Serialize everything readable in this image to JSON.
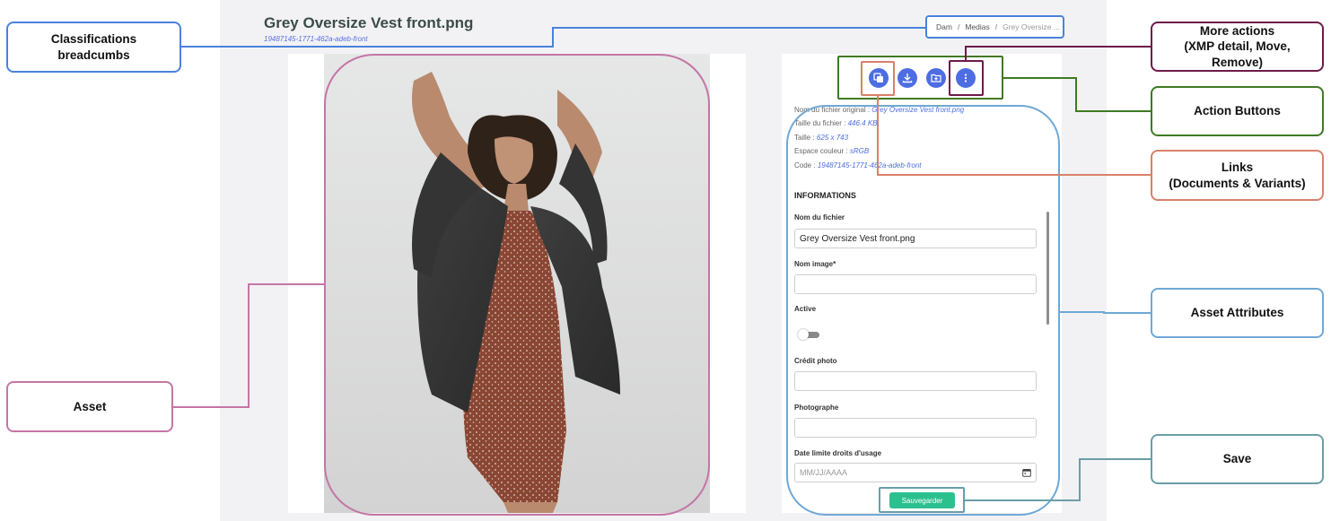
{
  "asset": {
    "title": "Grey Oversize Vest front.png",
    "code": "19487145-1771-462a-adeb-front"
  },
  "breadcrumb": {
    "items": [
      "Dam",
      "Medias"
    ],
    "current": "Grey Oversize ..."
  },
  "actions": {
    "buttons": [
      {
        "name": "documents-variants-links-button",
        "icon": "copy-icon"
      },
      {
        "name": "download-button",
        "icon": "download-icon"
      },
      {
        "name": "folder-add-button",
        "icon": "folder-plus-icon"
      },
      {
        "name": "more-actions-button",
        "icon": "more-vertical-icon"
      }
    ],
    "accent_color": "#4d6de3"
  },
  "metadata": {
    "original_filename_label": "Nom du fichier original :",
    "original_filename": "Grey Oversize Vest front.png",
    "file_size_label": "Taille du fichier :",
    "file_size": "446.4 KB",
    "dimensions_label": "Taille :",
    "dimensions": "625 x 743",
    "color_space_label": "Espace couleur :",
    "color_space": "sRGB",
    "code_label": "Code :",
    "code": "19487145-1771-462a-adeb-front"
  },
  "form": {
    "section_title": "INFORMATIONS",
    "filename_label": "Nom du fichier",
    "filename_value": "Grey Oversize Vest front.png",
    "image_name_label": "Nom image*",
    "image_name_value": "",
    "active_label": "Active",
    "active": false,
    "photo_credit_label": "Crédit photo",
    "photo_credit_value": "",
    "photographer_label": "Photographe",
    "photographer_value": "",
    "rights_date_label": "Date limite droits d'usage",
    "rights_date_placeholder": "MM/JJ/AAAA",
    "save_label": "Sauvegarder",
    "save_color": "#2cc08f"
  },
  "callouts": {
    "breadcrumbs": "Classifications\nbreadcumbs",
    "more_actions": "More actions\n(XMP detail, Move,\nRemove)",
    "action_buttons": "Action Buttons",
    "links": "Links\n(Documents & Variants)",
    "asset_attributes": "Asset Attributes",
    "asset": "Asset",
    "save": "Save"
  },
  "colors": {
    "breadcrumbs": "#4a82db",
    "more_actions": "#6e1a4a",
    "action_buttons": "#3f7a24",
    "links": "#d9806a",
    "asset_attributes": "#6fa8d6",
    "asset": "#c476a5",
    "save": "#6a9ea8"
  }
}
